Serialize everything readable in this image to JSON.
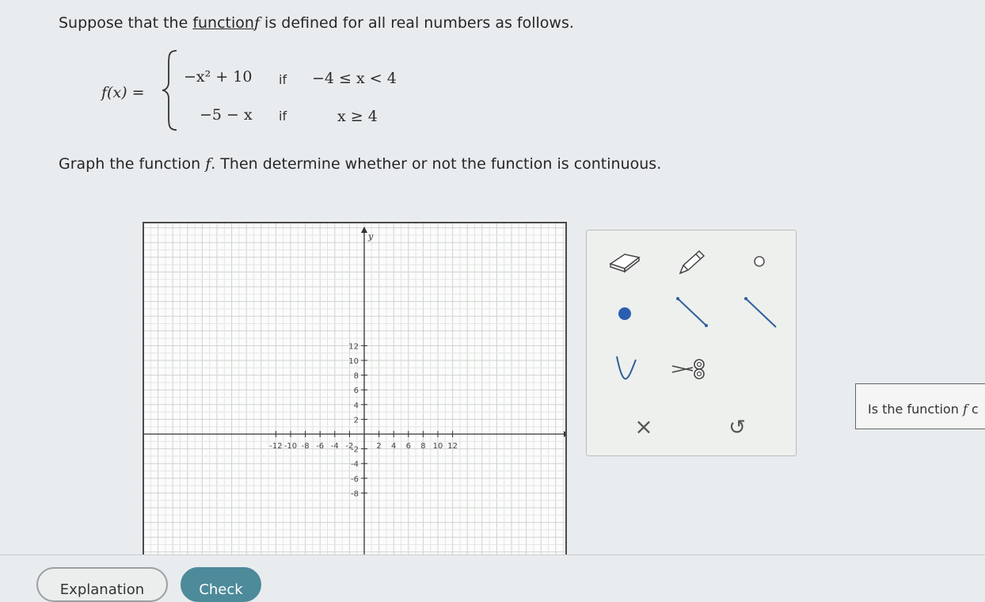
{
  "problem": {
    "line1_a": "Suppose that the ",
    "line1_link": "function",
    "line1_f": "f",
    "line1_b": " is defined for all real numbers as follows.",
    "fx": "f(x) =",
    "piece1_expr": "−x² + 10",
    "piece1_if": "if",
    "piece1_cond": "−4 ≤ x < 4",
    "piece2_expr": "−5 − x",
    "piece2_if": "if",
    "piece2_cond": "x ≥ 4",
    "line2_a": "Graph the function ",
    "line2_f": "f",
    "line2_b": ". Then determine whether or not the function is continuous."
  },
  "graph": {
    "y_axis_label": "y",
    "x_ticks": [
      "-12",
      "-10",
      "-8",
      "-6",
      "-4",
      "-2",
      "2",
      "4",
      "6",
      "8",
      "10",
      "12"
    ],
    "y_ticks": [
      "12",
      "10",
      "8",
      "6",
      "4",
      "2",
      "-2",
      "-4",
      "-6",
      "-8"
    ]
  },
  "tools": [
    {
      "name": "eraser-icon"
    },
    {
      "name": "pencil-icon"
    },
    {
      "name": "open-circle-icon"
    },
    {
      "name": "closed-dot-icon"
    },
    {
      "name": "segment-icon"
    },
    {
      "name": "ray-icon"
    },
    {
      "name": "parabola-icon"
    },
    {
      "name": "scissors-icon"
    }
  ],
  "tool_actions": {
    "clear_symbol": "×",
    "undo_symbol": "↺"
  },
  "question": {
    "text_a": "Is the function ",
    "text_f": "f",
    "text_b": " c"
  },
  "buttons": {
    "explanation": "Explanation",
    "check": "Check"
  },
  "colors": {
    "accent": "#4d8a9a",
    "dot": "#2a5fb0"
  }
}
